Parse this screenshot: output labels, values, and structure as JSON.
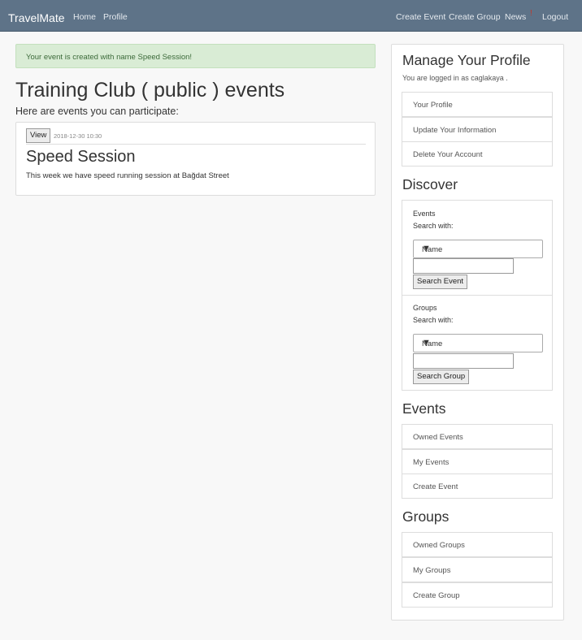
{
  "navbar": {
    "brand": "TravelMate",
    "left_links": [
      "Home",
      "Profile"
    ],
    "right_links": [
      "Create Event",
      "Create Group",
      "News",
      "Logout"
    ],
    "news_indicator": "!",
    "background_color": "#5e7388"
  },
  "alert": {
    "message": "Your event is created with name Speed Session!"
  },
  "main": {
    "title": "Training Club ( public ) events",
    "subtitle": "Here are events you can participate:",
    "event": {
      "view_label": "View",
      "date": "2018-12-30 10:30",
      "name": "Speed Session",
      "description": "This week we have speed running session at Bağdat Street"
    }
  },
  "sidebar": {
    "profile": {
      "heading": "Manage Your Profile",
      "logged_in_text": "You are logged in as caglakaya .",
      "items": [
        "Your Profile",
        "Update Your Information",
        "Delete Your Account"
      ]
    },
    "discover": {
      "heading": "Discover",
      "events_label": "Events",
      "events_search_with": "Search with:",
      "events_select_value": "Name",
      "events_button": "Search Event",
      "groups_label": "Groups",
      "groups_search_with": "Search with:",
      "groups_select_value": "Name",
      "groups_button": "Search Group"
    },
    "events": {
      "heading": "Events",
      "items": [
        "Owned Events",
        "My Events",
        "Create Event"
      ]
    },
    "groups": {
      "heading": "Groups",
      "items": [
        "Owned Groups",
        "My Groups",
        "Create Group"
      ]
    }
  }
}
